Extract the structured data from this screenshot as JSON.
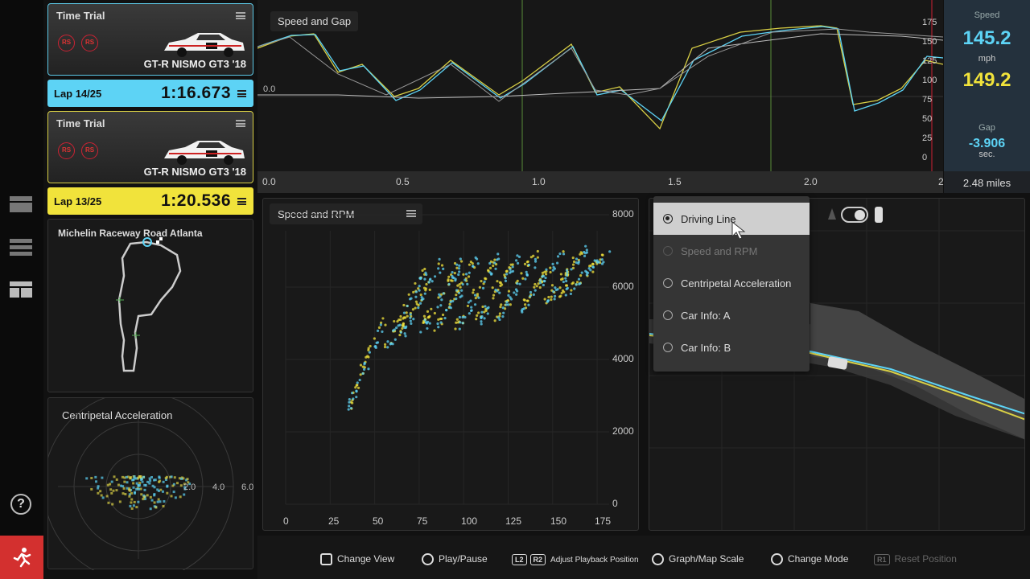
{
  "cards": [
    {
      "title": "Time Trial",
      "badges": [
        "RS",
        "RS"
      ],
      "car": "GT-R NISMO GT3 '18",
      "lap_label": "Lap 14/25",
      "lap_time": "1:16.673"
    },
    {
      "title": "Time Trial",
      "badges": [
        "RS",
        "RS"
      ],
      "car": "GT-R NISMO GT3 '18",
      "lap_label": "Lap 13/25",
      "lap_time": "1:20.536"
    }
  ],
  "track": {
    "name": "Michelin Raceway Road Atlanta"
  },
  "centripetal": {
    "title": "Centripetal Acceleration",
    "ticks": [
      "2.0",
      "4.0",
      "6.0"
    ]
  },
  "speed_gap": {
    "title": "Speed and Gap",
    "gap_zero": "0.0",
    "x_ticks": [
      "0.0",
      "0.5",
      "1.0",
      "1.5",
      "2.0",
      "2"
    ],
    "y_ticks": [
      "175",
      "150",
      "125",
      "100",
      "75",
      "50",
      "25",
      "0"
    ]
  },
  "readout": {
    "speed_label": "Speed",
    "speed_blue": "145.2",
    "unit": "mph",
    "speed_yellow": "149.2",
    "gap_label": "Gap",
    "gap_value": "-3.906",
    "gap_unit": "sec.",
    "distance": "2.48 miles"
  },
  "speed_rpm": {
    "title": "Speed and RPM",
    "y_ticks": [
      "8000",
      "6000",
      "4000",
      "2000",
      "0"
    ],
    "x_ticks": [
      "0",
      "25",
      "50",
      "75",
      "100",
      "125",
      "150",
      "175"
    ]
  },
  "dropdown": {
    "items": [
      "Driving Line",
      "Speed and RPM",
      "Centripetal Acceleration",
      "Car Info: A",
      "Car Info: B"
    ]
  },
  "controls": {
    "change_view": "Change View",
    "play_pause": "Play/Pause",
    "l2": "L2",
    "r2": "R2",
    "playback": "Adjust Playback Position",
    "scale": "Graph/Map Scale",
    "mode": "Change Mode",
    "r1": "R1",
    "reset": "Reset Position"
  },
  "colors": {
    "blue": "#5dd3f5",
    "yellow": "#f1e33b",
    "accent_red": "#d3302f"
  }
}
